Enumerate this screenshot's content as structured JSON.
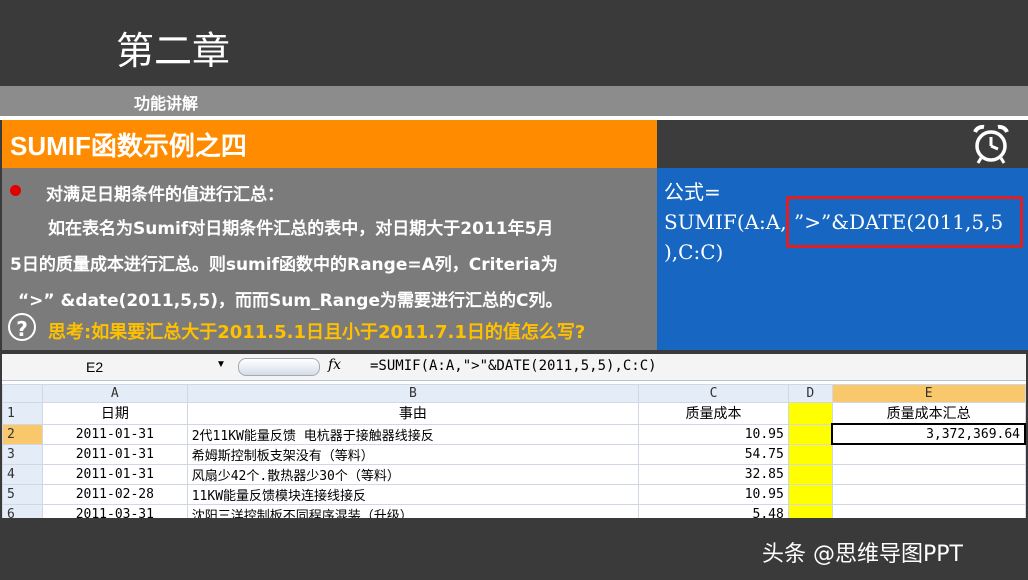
{
  "header": {
    "chapter_title": "第二章",
    "section_label": "功能讲解"
  },
  "slide": {
    "title": "SUMIF函数示例之四",
    "description": {
      "heading": "对满足日期条件的值进行汇总：",
      "line1": "如在表名为Sumif对日期条件汇总的表中，对日期大于2011年5月",
      "line2": "5日的质量成本进行汇总。则sumif函数中的Range=A列，Criteria为",
      "line3": "“>” &date(2011,5,5)，而而Sum_Range为需要进行汇总的C列。",
      "think": "思考:如果要汇总大于2011.5.1日且小于2011.7.1日的值怎么写?"
    },
    "formula": {
      "label": "公式=",
      "line1_prefix": "SUMIF(A:A,",
      "line1_highlight": "”>”&DATE(2011,5,5",
      "line2": "),C:C)"
    },
    "icons": [
      "alarm-clock-icon",
      "question-icon",
      "bullet-dot"
    ]
  },
  "spreadsheet": {
    "name_box": "E2",
    "fx_label": "fx",
    "formula_bar": "=SUMIF(A:A,\">\"&DATE(2011,5,5),C:C)",
    "columns": [
      "A",
      "B",
      "C",
      "D",
      "E"
    ],
    "header_row": {
      "row": "1",
      "a": "日期",
      "b": "事由",
      "c": "质量成本",
      "d": "",
      "e": "质量成本汇总"
    },
    "rows": [
      {
        "row": "2",
        "a": "2011-01-31",
        "b": "2代11KW能量反馈 电杭器于接触器线接反",
        "c": "10.95",
        "e": "3,372,369.64"
      },
      {
        "row": "3",
        "a": "2011-01-31",
        "b": "希姆斯控制板支架没有（等料）",
        "c": "54.75",
        "e": ""
      },
      {
        "row": "4",
        "a": "2011-01-31",
        "b": "风扇少42个.散热器少30个（等料）",
        "c": "32.85",
        "e": ""
      },
      {
        "row": "5",
        "a": "2011-02-28",
        "b": "11KW能量反馈模块连接线接反",
        "c": "10.95",
        "e": ""
      },
      {
        "row": "6",
        "a": "2011-03-31",
        "b": "沈阳三洋控制板不同程序混装（升级）",
        "c": "5.48",
        "e": ""
      }
    ],
    "colors": {
      "highlight_column": "#ffff00",
      "selected_header": "#f8c86a"
    }
  },
  "footer": {
    "watermark": "头条 @思维导图PPT"
  },
  "colors": {
    "orange": "#ff8c00",
    "blue": "#1766c2",
    "gray_panel": "#7b7b7b",
    "think_yellow": "#ffc000",
    "highlight_red": "#e02020"
  }
}
